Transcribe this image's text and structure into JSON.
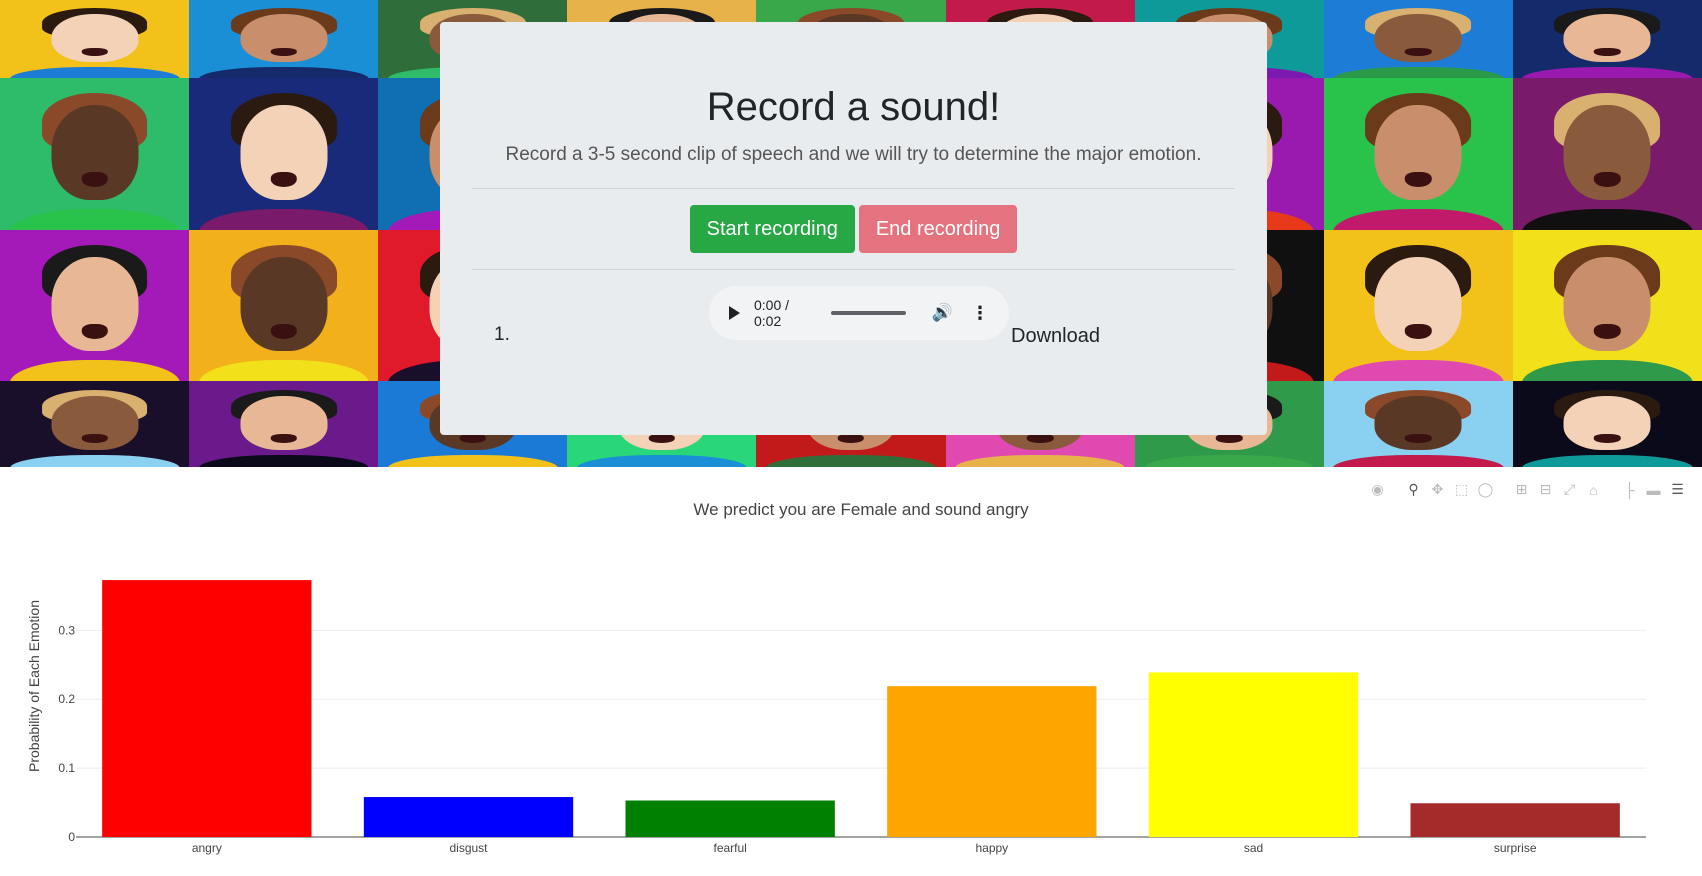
{
  "card": {
    "title": "Record a sound!",
    "lead": "Record a 3-5 second clip of speech and we will try to determine the major emotion.",
    "start_label": "Start recording",
    "end_label": "End recording",
    "recording_index": "1.",
    "player_time": "0:00 / 0:02",
    "download_label": "Download",
    "colors": {
      "start": "#28a745",
      "end": "#e4737f",
      "card_bg": "#e9ecef"
    }
  },
  "modebar": {
    "icons": [
      "camera-icon",
      "zoom-icon",
      "pan-icon",
      "box-select-icon",
      "lasso-icon",
      "zoom-in-icon",
      "zoom-out-icon",
      "autoscale-icon",
      "home-icon",
      "spike-lines-icon",
      "hover-closest-icon",
      "hover-compare-icon"
    ]
  },
  "chart_data": {
    "type": "bar",
    "title": "We predict you are Female and sound angry",
    "xlabel": "",
    "ylabel": "Probability of Each Emotion",
    "categories": [
      "angry",
      "disgust",
      "fearful",
      "happy",
      "sad",
      "surprise"
    ],
    "values": [
      0.373,
      0.058,
      0.053,
      0.219,
      0.239,
      0.049
    ],
    "colors": [
      "#ff0000",
      "#0000ff",
      "#008000",
      "#ffa500",
      "#ffff00",
      "#a52a2a"
    ],
    "yticks": [
      0,
      0.1,
      0.2,
      0.3
    ],
    "ytick_labels": [
      "0",
      "0.1",
      "0.2",
      "0.3"
    ],
    "ylim": [
      0,
      0.392
    ],
    "grid": true,
    "legend": "none"
  }
}
